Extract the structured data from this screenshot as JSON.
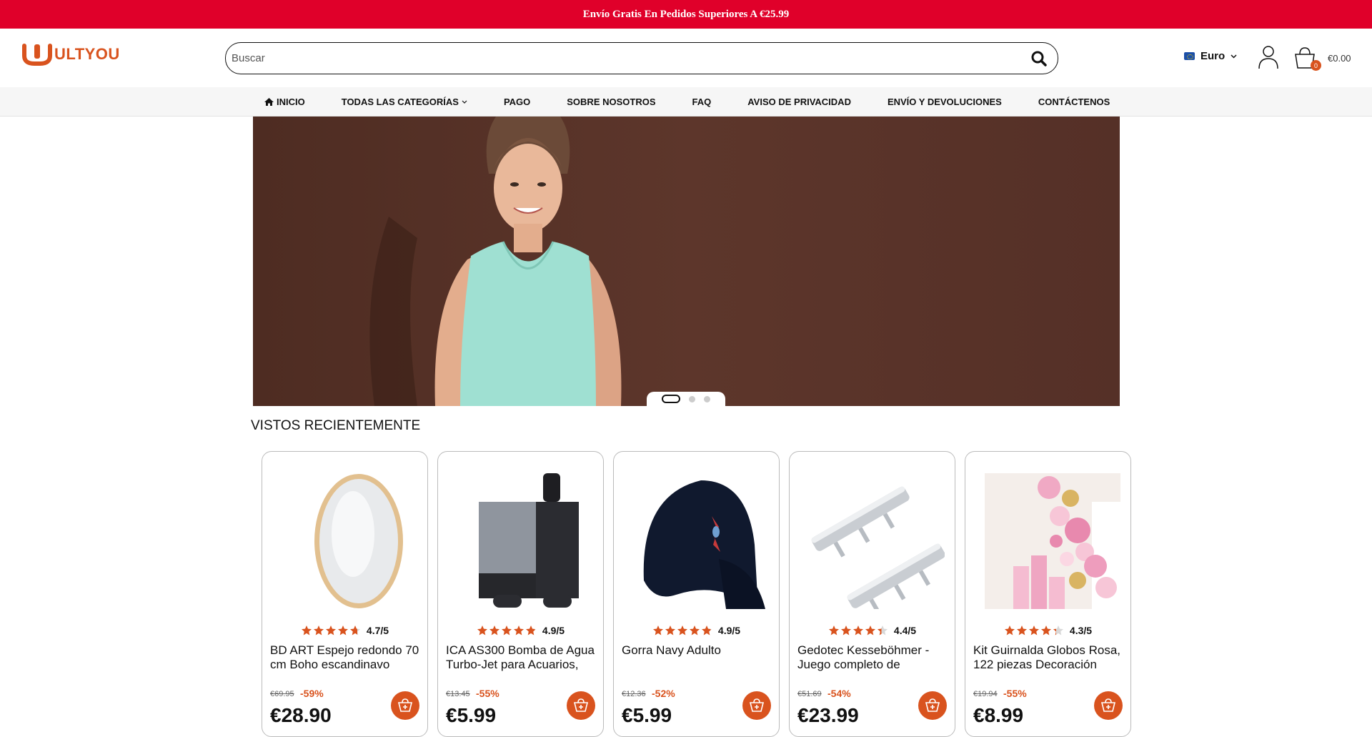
{
  "promo": {
    "text": "Envío Gratis En Pedidos Superiores A €25.99"
  },
  "header": {
    "logo_text": "ULTYOU",
    "search_placeholder": "Buscar",
    "currency": "Euro",
    "cart_count": "0",
    "cart_total": "€0.00"
  },
  "nav": {
    "items": [
      {
        "label": "INICIO",
        "icon": "home-icon"
      },
      {
        "label": "TODAS LAS CATEGORÍAS",
        "icon": "chevron-down-icon"
      },
      {
        "label": "PAGO"
      },
      {
        "label": "SOBRE NOSOTROS"
      },
      {
        "label": "FAQ"
      },
      {
        "label": "AVISO DE PRIVACIDAD"
      },
      {
        "label": "ENVÍO Y DEVOLUCIONES"
      },
      {
        "label": "CONTÁCTENOS"
      }
    ]
  },
  "hero": {
    "slides": 3,
    "active_slide": 1
  },
  "recent": {
    "title": "VISTOS RECIENTEMENTE",
    "products": [
      {
        "title": "BD ART Espejo redondo 70 cm Boho escandinavo",
        "rating": "4.7/5",
        "stars": 4.7,
        "old_price": "€69.95",
        "discount": "-59%",
        "price": "€28.90"
      },
      {
        "title": "ICA AS300 Bomba de Agua Turbo-Jet para Acuarios,",
        "rating": "4.9/5",
        "stars": 4.9,
        "old_price": "€13.45",
        "discount": "-55%",
        "price": "€5.99"
      },
      {
        "title": "Gorra Navy Adulto",
        "rating": "4.9/5",
        "stars": 4.9,
        "old_price": "€12.36",
        "discount": "-52%",
        "price": "€5.99"
      },
      {
        "title": "Gedotec Kesseböhmer - Juego completo de",
        "rating": "4.4/5",
        "stars": 4.4,
        "old_price": "€51.69",
        "discount": "-54%",
        "price": "€23.99"
      },
      {
        "title": "Kit Guirnalda Globos Rosa, 122 piezas Decoración",
        "rating": "4.3/5",
        "stars": 4.3,
        "old_price": "€19.94",
        "discount": "-55%",
        "price": "€8.99"
      }
    ]
  },
  "colors": {
    "promo": "#e0002a",
    "accent": "#d9531e",
    "hero_bg": "#5a3328"
  }
}
